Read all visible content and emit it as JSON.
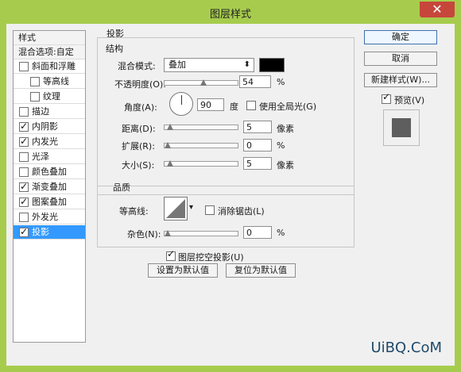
{
  "window": {
    "title": "图层样式",
    "close_symbol": "✕"
  },
  "styles_panel": {
    "header": "样式",
    "blend_options": "混合选项:自定",
    "items": [
      {
        "label": "斜面和浮雕",
        "checked": false,
        "indent": false
      },
      {
        "label": "等高线",
        "checked": false,
        "indent": true
      },
      {
        "label": "纹理",
        "checked": false,
        "indent": true
      },
      {
        "label": "描边",
        "checked": false,
        "indent": false
      },
      {
        "label": "内阴影",
        "checked": true,
        "indent": false
      },
      {
        "label": "内发光",
        "checked": true,
        "indent": false
      },
      {
        "label": "光泽",
        "checked": false,
        "indent": false
      },
      {
        "label": "颜色叠加",
        "checked": false,
        "indent": false
      },
      {
        "label": "渐变叠加",
        "checked": true,
        "indent": false
      },
      {
        "label": "图案叠加",
        "checked": true,
        "indent": false
      },
      {
        "label": "外发光",
        "checked": false,
        "indent": false
      },
      {
        "label": "投影",
        "checked": true,
        "indent": false,
        "selected": true
      }
    ]
  },
  "drop_shadow": {
    "group_title": "投影",
    "structure": {
      "title": "结构",
      "blend_mode_label": "混合模式:",
      "blend_mode_value": "叠加",
      "blend_color": "#000000",
      "opacity_label": "不透明度(O):",
      "opacity_value": "54",
      "opacity_unit": "%",
      "angle_label": "角度(A):",
      "angle_value": "90",
      "angle_unit": "度",
      "global_light_label": "使用全局光(G)",
      "global_light_checked": false,
      "distance_label": "距离(D):",
      "distance_value": "5",
      "distance_unit": "像素",
      "spread_label": "扩展(R):",
      "spread_value": "0",
      "spread_unit": "%",
      "size_label": "大小(S):",
      "size_value": "5",
      "size_unit": "像素"
    },
    "quality": {
      "title": "品质",
      "contour_label": "等高线:",
      "anti_alias_label": "消除锯齿(L)",
      "anti_alias_checked": false,
      "noise_label": "杂色(N):",
      "noise_value": "0",
      "noise_unit": "%"
    },
    "knockout_label": "图层挖空投影(U)",
    "knockout_checked": true,
    "set_default_button": "设置为默认值",
    "reset_default_button": "复位为默认值"
  },
  "right_panel": {
    "ok_button": "确定",
    "cancel_button": "取消",
    "new_style_button": "新建样式(W)...",
    "preview_label": "预览(V)",
    "preview_checked": true
  },
  "watermark": "UiBQ.CoM"
}
